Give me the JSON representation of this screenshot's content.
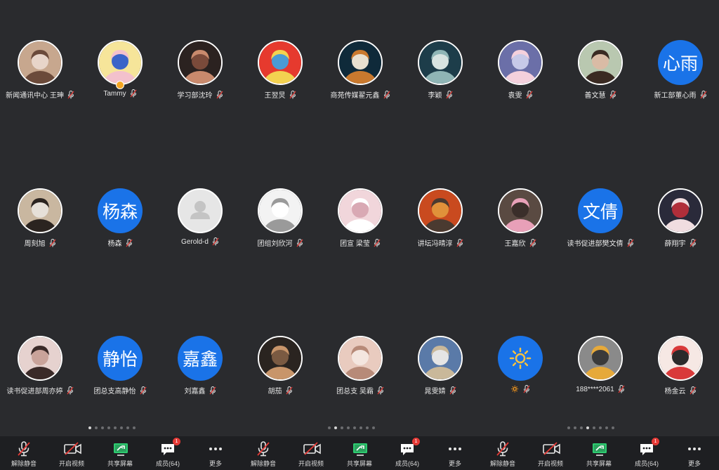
{
  "participants": [
    {
      "name": "新闻通讯中心 王珅",
      "avatar": "photo-girl-blonde",
      "colors": [
        "#c7a78e",
        "#6b4a3a",
        "#e8d5c9"
      ]
    },
    {
      "name": "Tammy",
      "avatar": "anime-sailor-moon",
      "colors": [
        "#f6e59a",
        "#f3c1cc",
        "#3b64c8"
      ],
      "host_badge": true
    },
    {
      "name": "学习部沈玲",
      "avatar": "photo-smiling-woman",
      "colors": [
        "#2b2220",
        "#c98a6d",
        "#7a4a3a"
      ]
    },
    {
      "name": "王翌炅",
      "avatar": "cartoon-crayon-shin",
      "colors": [
        "#e63a2e",
        "#f3d250",
        "#4b9bd4"
      ]
    },
    {
      "name": "商苑传媒翟元鑫",
      "avatar": "cartoon-fox",
      "colors": [
        "#0f2a3a",
        "#c9792e",
        "#e8e0d0"
      ]
    },
    {
      "name": "李颖",
      "avatar": "anime-scene",
      "colors": [
        "#1d3d4a",
        "#8fb5b5",
        "#d8e3e0"
      ]
    },
    {
      "name": "袁雯",
      "avatar": "cartoon-tom-cat",
      "colors": [
        "#6b6fa8",
        "#f4d0dc",
        "#c7c9e8"
      ]
    },
    {
      "name": "善文慧",
      "avatar": "photo-child",
      "colors": [
        "#b9c8b0",
        "#3a2a22",
        "#d9bba5"
      ]
    },
    {
      "name": "新工部董心雨",
      "avatar_text": "心雨"
    },
    {
      "name": "周刻旭",
      "avatar": "photo-young-man",
      "colors": [
        "#c9b7a0",
        "#2b2420",
        "#e6e0d8"
      ]
    },
    {
      "name": "杨森",
      "avatar_text": "杨森"
    },
    {
      "name": "Gerold-d",
      "avatar": "default-person"
    },
    {
      "name": "团组刘欣河",
      "avatar": "sketch-drawing",
      "colors": [
        "#f3f3f3",
        "#9a9a9a",
        "#ffffff"
      ]
    },
    {
      "name": "团宣 梁莹",
      "avatar": "photo-white-cat",
      "colors": [
        "#f1d6db",
        "#ffffff",
        "#d9a9b4"
      ]
    },
    {
      "name": "讲坛冯晴淳",
      "avatar": "photo-cat-orange",
      "colors": [
        "#c94a1f",
        "#4a3a30",
        "#e0913a"
      ]
    },
    {
      "name": "王嘉欣",
      "avatar": "photo-pink-hair",
      "colors": [
        "#5a4a42",
        "#e8a0b8",
        "#3a2e2a"
      ]
    },
    {
      "name": "读书促进部樊文倩",
      "avatar_text": "文倩"
    },
    {
      "name": "薛翔宇",
      "avatar": "anime-dark-hair",
      "colors": [
        "#2a2a3a",
        "#f0dde0",
        "#b02e3a"
      ]
    },
    {
      "name": "读书促进部周亦婷",
      "avatar": "photo-girl-bangs",
      "colors": [
        "#e6d2cf",
        "#3a2a28",
        "#c9a39a"
      ]
    },
    {
      "name": "团总支高静怡",
      "avatar_text": "静怡"
    },
    {
      "name": "刘嘉鑫",
      "avatar_text": "嘉鑫"
    },
    {
      "name": "胡茄",
      "avatar": "photo-man-glasses",
      "colors": [
        "#2a2420",
        "#c8956a",
        "#7a5a42"
      ]
    },
    {
      "name": "团总支 吴霜",
      "avatar": "photo-little-girl",
      "colors": [
        "#e9cbbf",
        "#b78a78",
        "#f4e6df"
      ]
    },
    {
      "name": "晁雯婧",
      "avatar": "photo-street",
      "colors": [
        "#5a7aa8",
        "#c9b89a",
        "#e5e5e5"
      ]
    },
    {
      "name": "🔅",
      "avatar": "sun-icon"
    },
    {
      "name": "188****2061",
      "avatar": "photo-walking-person",
      "colors": [
        "#8a8a8a",
        "#e6a93a",
        "#3a3a3a"
      ]
    },
    {
      "name": "杨金云",
      "avatar": "cartoon-girl-flag",
      "colors": [
        "#f6e8e4",
        "#d93a3a",
        "#2b2b2b"
      ]
    }
  ],
  "toolbar": {
    "mute_label": "解除静音",
    "video_label": "开启视频",
    "share_label": "共享屏幕",
    "members_label": "成员(64)",
    "members_badge": "1",
    "more_label": "更多"
  },
  "pagination": {
    "count": 8,
    "active_index_per_group": [
      0,
      1,
      3
    ]
  },
  "colors": {
    "background": "#2a2b2e",
    "toolbar": "#1e1f22",
    "accent": "#1a73e8",
    "mic_red": "#e53935",
    "share_green": "#2ecc71"
  }
}
